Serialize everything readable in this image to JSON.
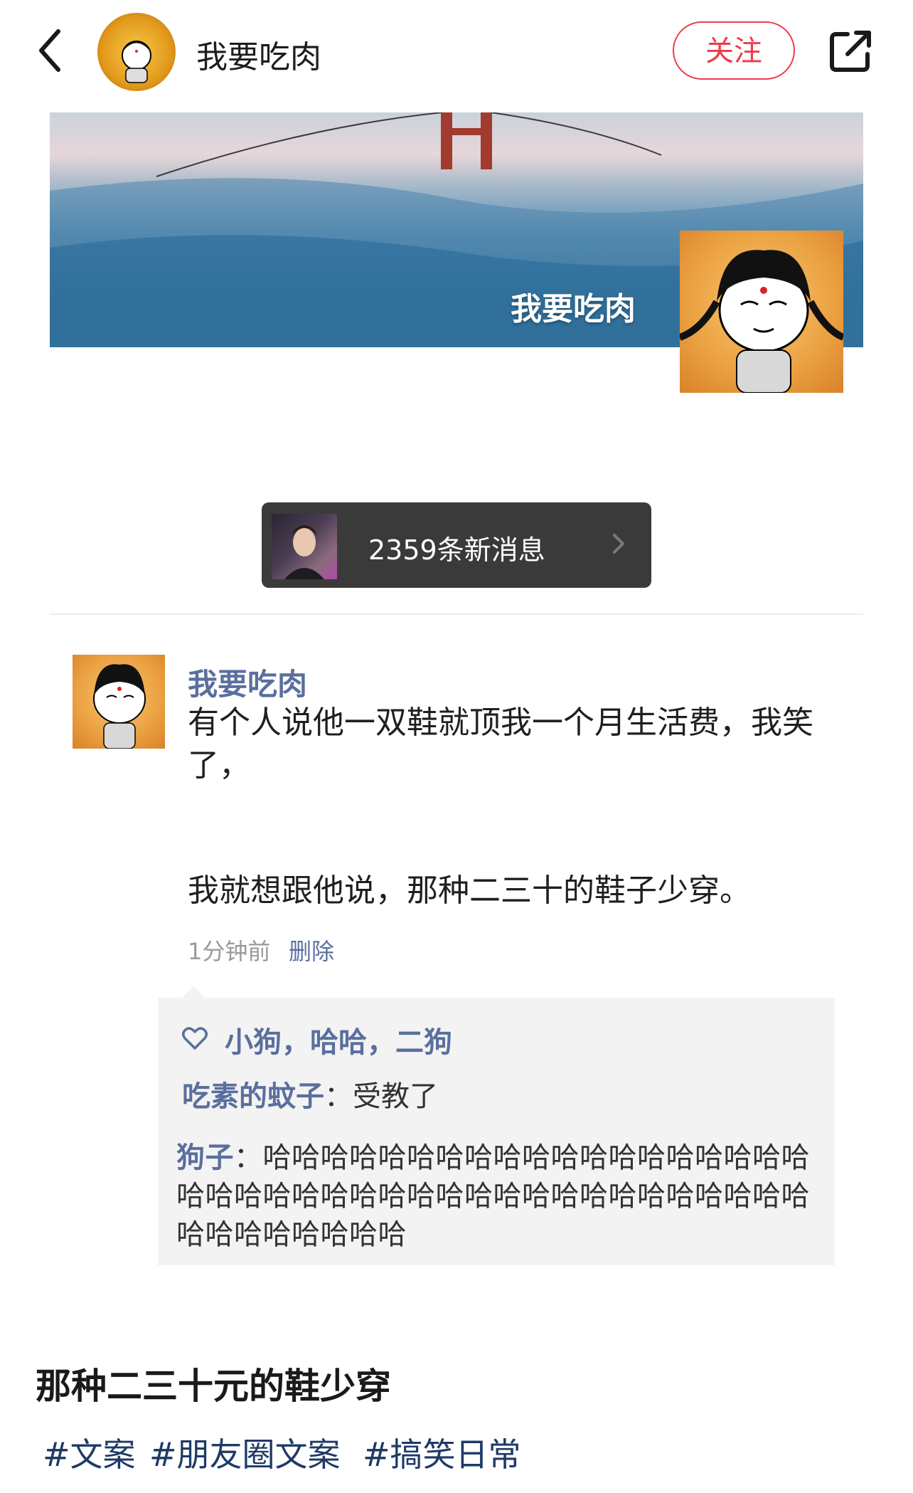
{
  "header": {
    "title": "我要吃肉",
    "follow_label": "关注"
  },
  "banner": {
    "name": "我要吃肉"
  },
  "toast": {
    "text": "2359条新消息"
  },
  "post": {
    "author": "我要吃肉",
    "line1": "有个人说他一双鞋就顶我一个月生活费，我笑",
    "line2": "了，",
    "line3": "我就想跟他说，那种二三十的鞋子少穿。",
    "time": "1分钟前",
    "delete_label": "删除",
    "likes": "小狗，哈哈，二狗",
    "comments": [
      {
        "name": "吃素的蚊子",
        "sep": "：",
        "text": "受教了"
      },
      {
        "name": "狗子",
        "sep": "：",
        "text": "哈哈哈哈哈哈哈哈哈哈哈哈哈哈哈哈哈哈哈哈哈哈哈哈哈哈哈哈哈哈哈哈哈哈哈哈哈哈哈哈哈哈哈哈哈哈哈哈哈"
      }
    ]
  },
  "caption": "那种二三十元的鞋少穿",
  "tags": [
    "#文案",
    "#朋友圈文案",
    "#搞笑日常"
  ],
  "colors": {
    "accent_red": "#f03c4a",
    "link_blue": "#5a6f9e",
    "tag_blue": "#1e3a66"
  }
}
